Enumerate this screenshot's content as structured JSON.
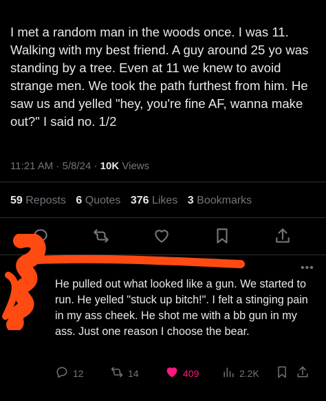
{
  "post": {
    "text": "I met a random man in the woods once. I was 11. Walking with my best friend. A guy around 25 yo was standing by a tree. Even at 11 we knew to avoid strange men. We took the path furthest from him. He saw us and yelled \"hey, you're fine AF, wanna make out?\" I said no. 1/2",
    "time": "11:21 AM",
    "date": "5/8/24",
    "views_count": "10K",
    "views_label": "Views"
  },
  "stats": {
    "reposts_count": "59",
    "reposts_label": "Reposts",
    "quotes_count": "6",
    "quotes_label": "Quotes",
    "likes_count": "376",
    "likes_label": "Likes",
    "bookmarks_count": "3",
    "bookmarks_label": "Bookmarks"
  },
  "actions": [
    "reply-icon",
    "repost-icon",
    "like-icon",
    "bookmark-icon",
    "share-icon"
  ],
  "reply": {
    "more": "•••",
    "text": "He pulled out what looked like a gun. We started to run. He yelled \"stuck up bitch!\". I felt a stinging pain in my ass cheek. He shot me with a bb gun in my ass. Just one reason I choose the bear.",
    "replies": "12",
    "reposts": "14",
    "likes": "409",
    "views": "2.2K"
  },
  "colors": {
    "background": "#000000",
    "text": "#e7e9ea",
    "muted": "#71767b",
    "like": "#f91880",
    "redaction": "#ff4a12"
  }
}
